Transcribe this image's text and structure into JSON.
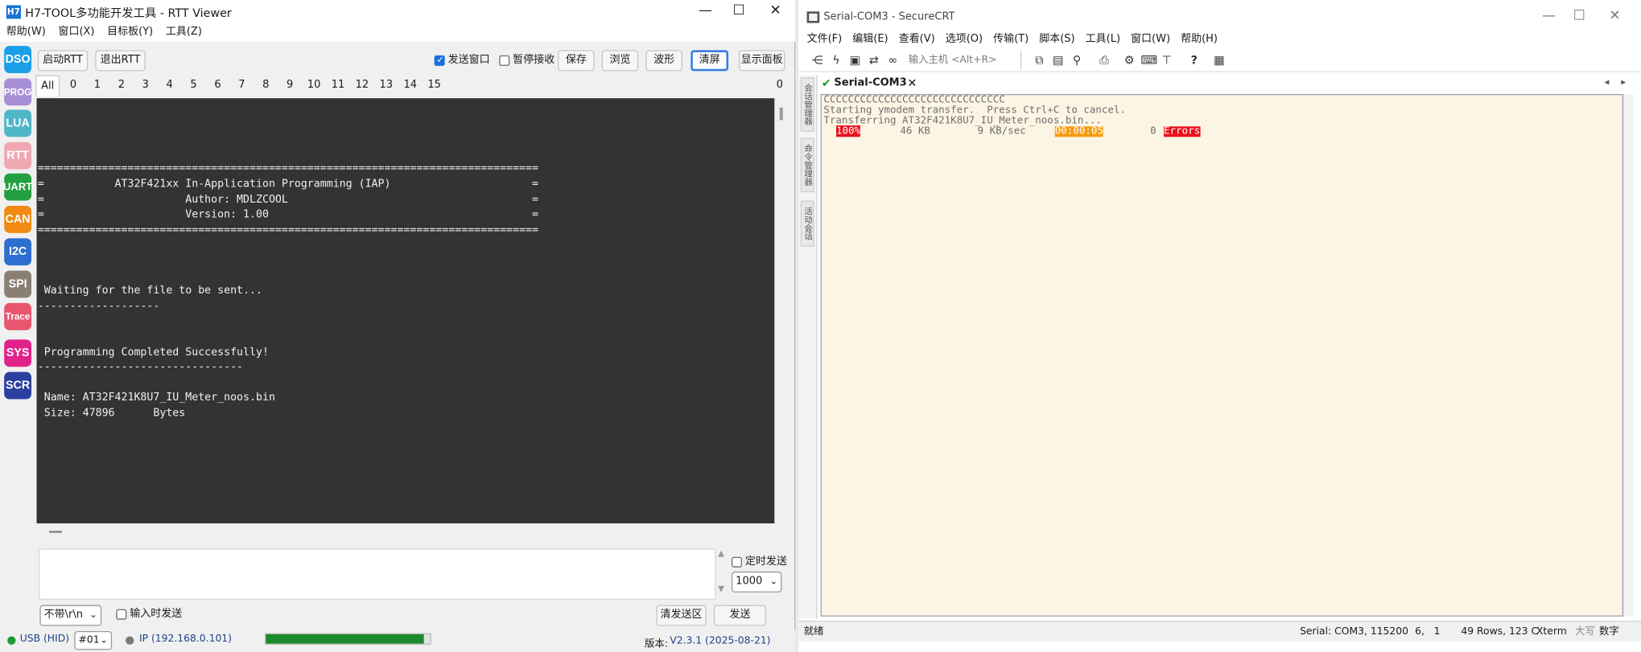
{
  "h7": {
    "app_icon": "H7",
    "title": "H7-TOOL多功能开发工具 - RTT Viewer",
    "window_controls": [
      "minimize-icon",
      "maximize-icon",
      "close-icon"
    ],
    "menu": [
      "帮助(W)",
      "窗口(X)",
      "目标板(Y)",
      "工具(Z)"
    ],
    "side_buttons": [
      {
        "label": "DSO",
        "color": "#1aa0e8"
      },
      {
        "label": "PROG",
        "color": "#a78fd6"
      },
      {
        "label": "LUA",
        "color": "#4fb6c8"
      },
      {
        "label": "RTT",
        "color": "#f0a8b2"
      },
      {
        "label": "UART",
        "color": "#23a042"
      },
      {
        "label": "CAN",
        "color": "#f08a12"
      },
      {
        "label": "I2C",
        "color": "#2d6fd0"
      },
      {
        "label": "SPI",
        "color": "#8a7f74"
      },
      {
        "label": "Trace",
        "color": "#e8556e"
      },
      {
        "label": "SYS",
        "color": "#e0228a"
      },
      {
        "label": "SCR",
        "color": "#2b3f9e"
      }
    ],
    "toolbar": {
      "start_rtt": "启动RTT",
      "exit_rtt": "退出RTT",
      "send_window": "发送窗口",
      "pause_receive": "暂停接收",
      "save": "保存",
      "browse": "浏览",
      "waveform": "波形",
      "clear": "清屏",
      "show_panel": "显示面板"
    },
    "tabs": [
      "All",
      "0",
      "1",
      "2",
      "3",
      "4",
      "5",
      "6",
      "7",
      "8",
      "9",
      "10",
      "11",
      "12",
      "13",
      "14",
      "15"
    ],
    "tab_right_count": "0",
    "console_lines": [
      "",
      "",
      "",
      "",
      "==============================================================================",
      "=           AT32F421xx In-Application Programming (IAP)                      =",
      "=                      Author: MDLZCOOL                                      =",
      "=                      Version: 1.00                                         =",
      "==============================================================================",
      "",
      "",
      "",
      " Waiting for the file to be sent...",
      "-------------------",
      "",
      "",
      " Programming Completed Successfully!",
      "--------------------------------",
      "",
      " Name: AT32F421K8U7_IU_Meter_noos.bin",
      " Size: 47896      Bytes"
    ],
    "send": {
      "timed_send": "定时发送",
      "interval": "1000",
      "line_ending": "不带\\r\\n",
      "send_on_input": "输入时发送",
      "clear_send": "清发送区",
      "send": "发送"
    },
    "status": {
      "usb": "USB (HID)",
      "device": "#01",
      "ip": "IP (192.168.0.101)",
      "version_label": "版本:",
      "version": "V2.3.1 (2025-08-21)",
      "progress": 0.96,
      "usb_color": "#1e9a3a",
      "ip_color": "#7a7a7a"
    }
  },
  "crt": {
    "title": "Serial-COM3 - SecureCRT",
    "menu": [
      "文件(F)",
      "编辑(E)",
      "查看(V)",
      "选项(O)",
      "传输(T)",
      "脚本(S)",
      "工具(L)",
      "窗口(W)",
      "帮助(H)"
    ],
    "host_placeholder": "输入主机 <Alt+R>",
    "toolbar_icons": [
      "connect-bar-icon",
      "lightning-icon",
      "terminal-icon",
      "reconnect-icon",
      "link-icon",
      "copy-icon",
      "paste-icon",
      "find-icon",
      "print-icon",
      "settings-icon",
      "keymap-icon",
      "sftp-icon",
      "help-icon",
      "screen-icon"
    ],
    "session_tab": "Serial-COM3",
    "side_panes": [
      "会话管理器",
      "命令管理器",
      "活动会话"
    ],
    "terminal": {
      "line1": "CCCCCCCCCCCCCCCCCCCCCCCCCCCCCC",
      "line2": "Starting ymodem transfer.  Press Ctrl+C to cancel.",
      "line3": "Transferring AT32F421K8U7_IU_Meter_noos.bin...",
      "percent": "100%",
      "size": "46 KB",
      "rate": "9 KB/sec",
      "elapsed": "00:00:05",
      "error_count": "0",
      "errors": "Errors"
    },
    "status": {
      "ready": "就绪",
      "port": "Serial: COM3, 115200",
      "cursor": "6,   1",
      "size": "49 Rows, 123 C",
      "emulation": "Xterm",
      "caps": "大写",
      "num": "数字"
    }
  }
}
